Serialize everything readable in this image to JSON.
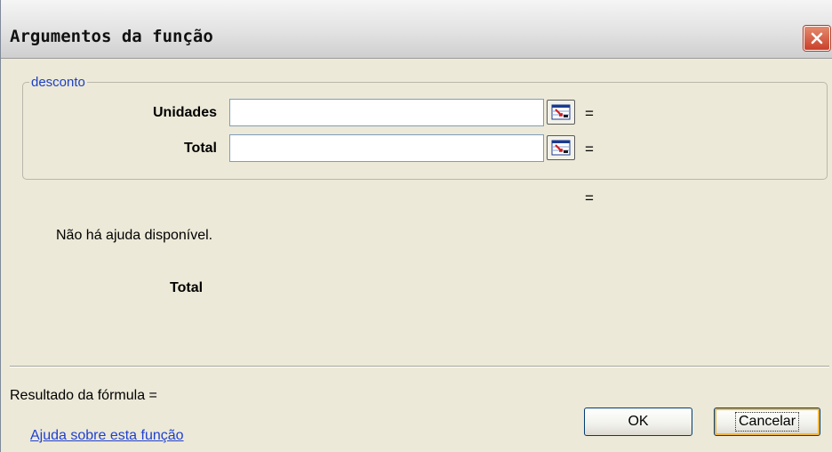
{
  "window": {
    "title": "Argumentos da função"
  },
  "group": {
    "legend": "desconto"
  },
  "arguments": [
    {
      "label": "Unidades",
      "value": "",
      "equals": "="
    },
    {
      "label": "Total",
      "value": "",
      "equals": "="
    }
  ],
  "result_equals": "=",
  "description": "Não há ajuda disponível.",
  "current_argument_label": "Total",
  "formula_result": "Resultado da fórmula =",
  "help_link": "Ajuda sobre esta função",
  "buttons": {
    "ok": "OK",
    "cancel": "Cancelar"
  },
  "colors": {
    "dialog_background": "#ece9d8",
    "legend_text": "#1c3fc4",
    "link": "#1f3fd1",
    "close_button": "#c9402a"
  }
}
